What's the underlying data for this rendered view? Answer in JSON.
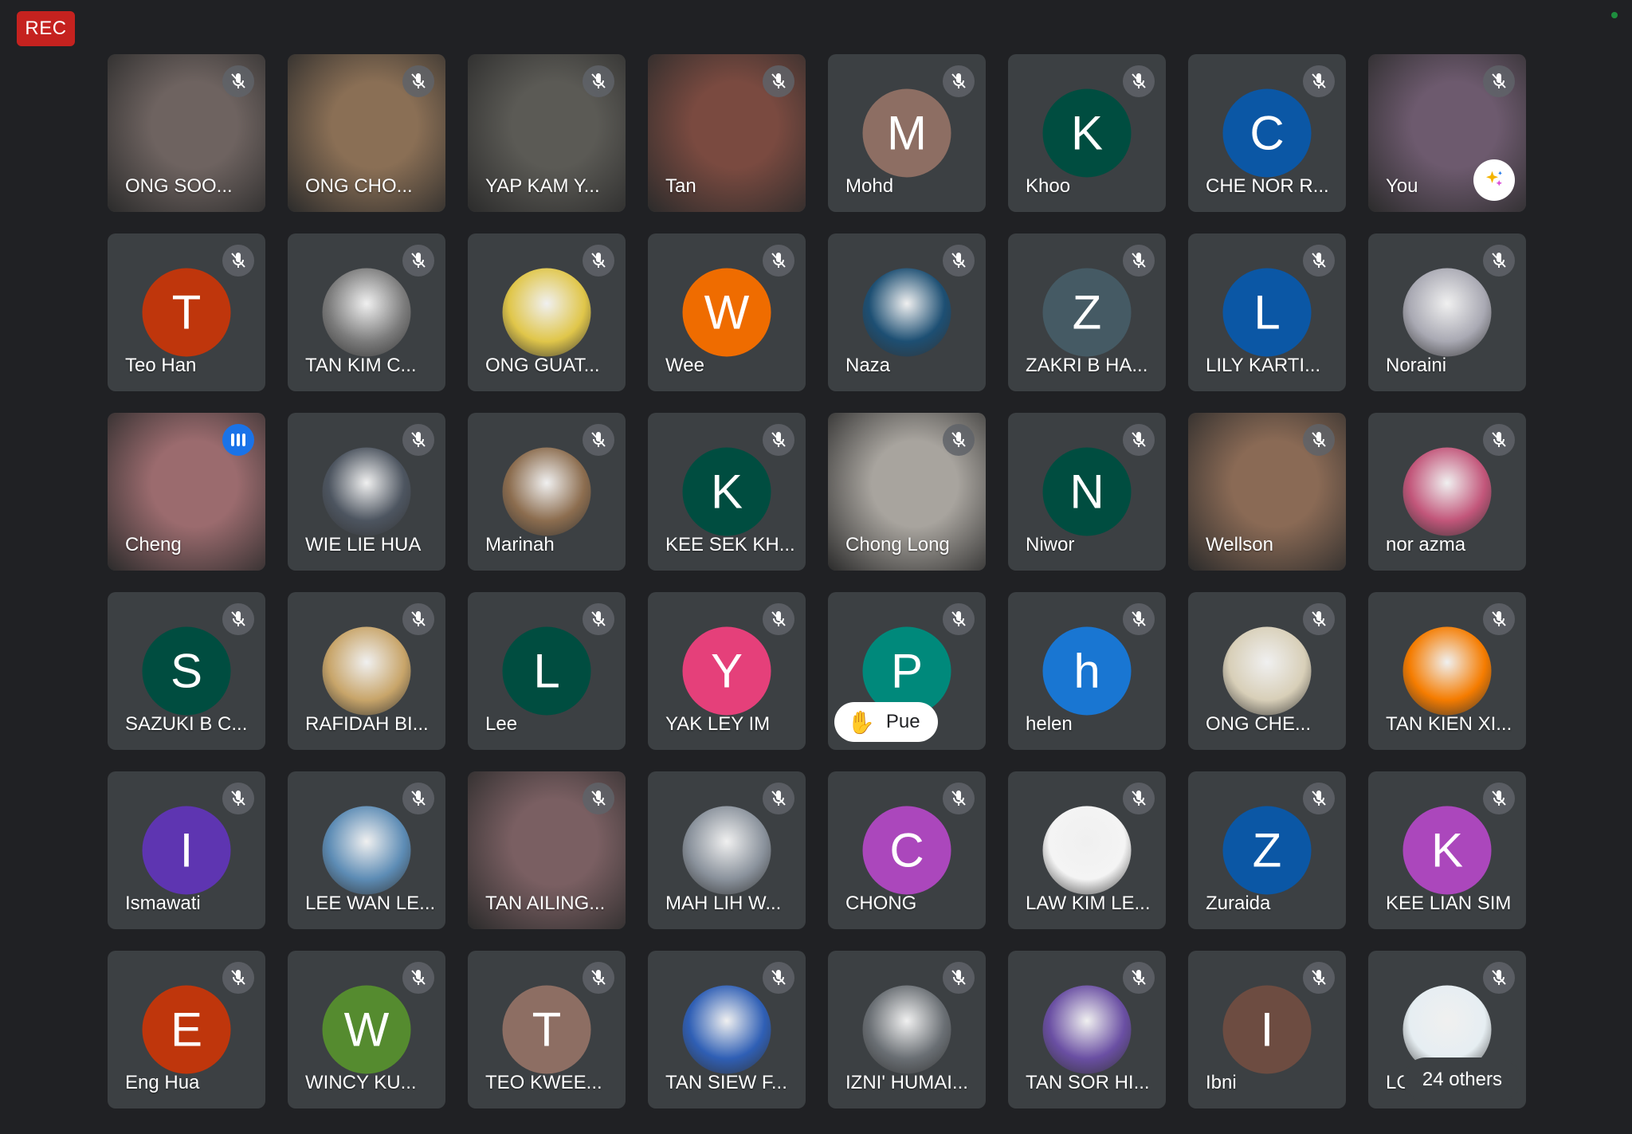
{
  "rec": {
    "label": "REC"
  },
  "you_tile_effects_icon": "sparkle-icon",
  "participants": [
    {
      "name": "ONG SOO...",
      "type": "video",
      "bg": "#6e6360",
      "muted": true
    },
    {
      "name": "ONG CHO...",
      "type": "video",
      "bg": "#8a6f55",
      "muted": true
    },
    {
      "name": "YAP KAM Y...",
      "type": "video",
      "bg": "#5b5a55",
      "muted": true
    },
    {
      "name": "Tan",
      "type": "video",
      "bg": "#7a4a40",
      "muted": true
    },
    {
      "name": "Mohd",
      "type": "letter",
      "letter": "M",
      "color": "#8d6e63",
      "muted": true
    },
    {
      "name": "Khoo",
      "type": "letter",
      "letter": "K",
      "color": "#004d40",
      "muted": true
    },
    {
      "name": "CHE NOR R...",
      "type": "letter",
      "letter": "C",
      "color": "#0b57a5",
      "muted": true
    },
    {
      "name": "You",
      "type": "video",
      "bg": "#6d5a6e",
      "muted": true,
      "effects": true
    },
    {
      "name": "Teo Han",
      "type": "letter",
      "letter": "T",
      "color": "#bf360c",
      "muted": true
    },
    {
      "name": "TAN KIM C...",
      "type": "photo",
      "color": "#7c7c7c",
      "muted": true
    },
    {
      "name": "ONG GUAT...",
      "type": "photo",
      "color": "#e0c64a",
      "muted": true
    },
    {
      "name": "Wee",
      "type": "letter",
      "letter": "W",
      "color": "#ef6c00",
      "muted": true
    },
    {
      "name": "Naza",
      "type": "photo",
      "color": "#1d4f73",
      "muted": true
    },
    {
      "name": "ZAKRI B HA...",
      "type": "letter",
      "letter": "Z",
      "color": "#455a64",
      "muted": true
    },
    {
      "name": "LILY KARTI...",
      "type": "letter",
      "letter": "L",
      "color": "#0b57a5",
      "muted": true
    },
    {
      "name": "Noraini",
      "type": "photo",
      "color": "#a9a9b3",
      "muted": true
    },
    {
      "name": "Cheng",
      "type": "video",
      "bg": "#9b6b6e",
      "muted": false,
      "speaking": true
    },
    {
      "name": "WIE LIE HUA",
      "type": "photo",
      "color": "#4d5560",
      "muted": true
    },
    {
      "name": "Marinah",
      "type": "photo",
      "color": "#8c6d4f",
      "muted": true
    },
    {
      "name": "KEE SEK KH...",
      "type": "letter",
      "letter": "K",
      "color": "#004d40",
      "muted": true
    },
    {
      "name": "Chong Long",
      "type": "video",
      "bg": "#a8a49e",
      "muted": true
    },
    {
      "name": "Niwor",
      "type": "letter",
      "letter": "N",
      "color": "#004d40",
      "muted": true
    },
    {
      "name": "Wellson",
      "type": "video",
      "bg": "#8a6a55",
      "muted": true
    },
    {
      "name": "nor azma",
      "type": "photo",
      "color": "#c2567a",
      "muted": true
    },
    {
      "name": "SAZUKI B C...",
      "type": "letter",
      "letter": "S",
      "color": "#004d40",
      "muted": true
    },
    {
      "name": "RAFIDAH BI...",
      "type": "photo",
      "color": "#c8a56a",
      "muted": true
    },
    {
      "name": "Lee",
      "type": "letter",
      "letter": "L",
      "color": "#004d40",
      "muted": true
    },
    {
      "name": "YAK LEY IM",
      "type": "letter",
      "letter": "Y",
      "color": "#e5407a",
      "muted": true
    },
    {
      "name": "Pue",
      "type": "letter",
      "letter": "P",
      "color": "#00897b",
      "muted": true,
      "hand": true
    },
    {
      "name": "helen",
      "type": "letter",
      "letter": "h",
      "color": "#1976d2",
      "muted": true
    },
    {
      "name": "ONG CHE...",
      "type": "photo",
      "color": "#d8cfb8",
      "muted": true
    },
    {
      "name": "TAN KIEN XI...",
      "type": "photo",
      "color": "#f57c00",
      "muted": true
    },
    {
      "name": "Ismawati",
      "type": "letter",
      "letter": "I",
      "color": "#5e35b1",
      "muted": true
    },
    {
      "name": "LEE WAN LE...",
      "type": "photo",
      "color": "#5d8cb5",
      "muted": true
    },
    {
      "name": "TAN AILING...",
      "type": "video",
      "bg": "#7a5f62",
      "muted": true
    },
    {
      "name": "MAH LIH W...",
      "type": "photo",
      "color": "#8a929c",
      "muted": true
    },
    {
      "name": "CHONG",
      "type": "letter",
      "letter": "C",
      "color": "#ab47bc",
      "muted": true
    },
    {
      "name": "LAW KIM LE...",
      "type": "photo",
      "color": "#f4f4f4",
      "muted": true
    },
    {
      "name": "Zuraida",
      "type": "letter",
      "letter": "Z",
      "color": "#0b57a5",
      "muted": true
    },
    {
      "name": "KEE LIAN SIM",
      "type": "letter",
      "letter": "K",
      "color": "#ab47bc",
      "muted": true
    },
    {
      "name": "Eng Hua",
      "type": "letter",
      "letter": "E",
      "color": "#bf360c",
      "muted": true
    },
    {
      "name": "WINCY KU...",
      "type": "letter",
      "letter": "W",
      "color": "#558b2f",
      "muted": true
    },
    {
      "name": "TEO KWEE...",
      "type": "letter",
      "letter": "T",
      "color": "#8d6e63",
      "muted": true
    },
    {
      "name": "TAN SIEW F...",
      "type": "photo",
      "color": "#2f5fb5",
      "muted": true
    },
    {
      "name": "IZNI' HUMAI...",
      "type": "photo",
      "color": "#6a6f74",
      "muted": true
    },
    {
      "name": "TAN SOR HI...",
      "type": "photo",
      "color": "#6a4fa3",
      "muted": true
    },
    {
      "name": "Ibni",
      "type": "letter",
      "letter": "I",
      "color": "#6d4c41",
      "muted": true
    },
    {
      "name": "LC",
      "type": "photo",
      "color": "#e6eef2",
      "muted": true,
      "others": "24 others"
    }
  ]
}
